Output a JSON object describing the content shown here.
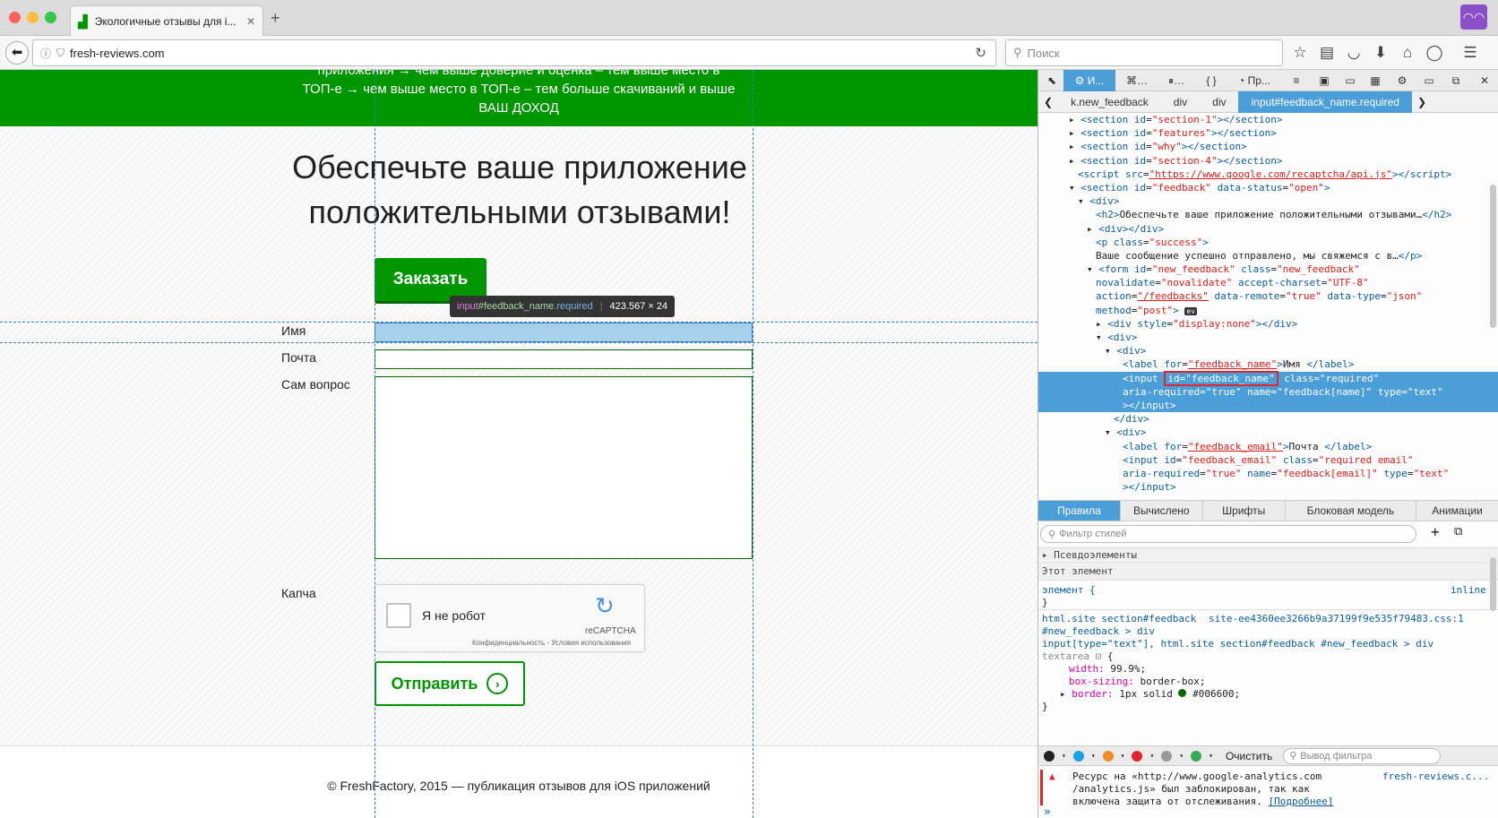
{
  "browser": {
    "tab_title": "Экологичные отзывы для i...",
    "new_tab": "+",
    "url": "fresh-reviews.com",
    "search_placeholder": "Поиск"
  },
  "page": {
    "banner_line1": "приложения → чем выше доверие и оценка – тем выше место в",
    "banner_line2": "ТОП-е → чем выше место в ТОП-е – тем больше скачиваний и выше",
    "banner_line3": "ВАШ ДОХОД",
    "title_line1": "Обеспечьте ваше приложение",
    "title_line2": "положительными отзывами!",
    "order_button": "Заказать",
    "label_name": "Имя",
    "label_email": "Почта",
    "label_question": "Сам вопрос",
    "label_captcha": "Капча",
    "captcha_text": "Я не робот",
    "captcha_brand": "reCAPTCHA",
    "captcha_links": "Конфиденциальность - Условия использования",
    "send_button": "Отправить",
    "footer": "© FreshFactory, 2015 — публикация отзывов для iOS приложений"
  },
  "tooltip": {
    "tag": "input",
    "id": "#feedback_name",
    "cls": ".required",
    "size": "423.567 × 24"
  },
  "devtools": {
    "inspector_tab": "И...",
    "perf_tab": "Пр...",
    "breadcrumbs": [
      "k.new_feedback",
      "div",
      "div",
      "input#feedback_name.required"
    ],
    "rule_tabs": [
      "Правила",
      "Вычислено",
      "Шрифты",
      "Блоковая модель",
      "Анимации"
    ],
    "filter_placeholder": "Фильтр стилей",
    "pseudo": "Псевдоэлементы",
    "this_element": "Этот элемент",
    "element_rule": "элемент {",
    "inline": "inline",
    "close_brace": "}",
    "selector1": "html.site section#feedback",
    "source1": "site-ee4360ee3266b9a37199f9e535f79483.css:1",
    "selector1b": "#new_feedback > div",
    "selector2": "input[type=\"text\"], html.site section#feedback #new_feedback > div",
    "selector2b": "textarea",
    "open_brace": "{",
    "prop1": "width:",
    "val1": "99.9%;",
    "prop2": "box-sizing:",
    "val2": "border-box;",
    "prop3": "border:",
    "val3": "1px solid",
    "val3b": "#006600;",
    "console_clear": "Очистить",
    "console_filter": "Вывод фильтра",
    "console_msg1": "Ресурс на «http://www.google-analytics.com",
    "console_msg2": "/analytics.js» был заблокирован, так как",
    "console_msg3": "включена защита от отслеживания.",
    "console_more": "[Подробнее]",
    "console_source": "fresh-reviews.c...",
    "prompt": "»"
  },
  "colors": {
    "green": "#009600",
    "dark_green": "#006600",
    "selection": "#4c9ed9"
  }
}
